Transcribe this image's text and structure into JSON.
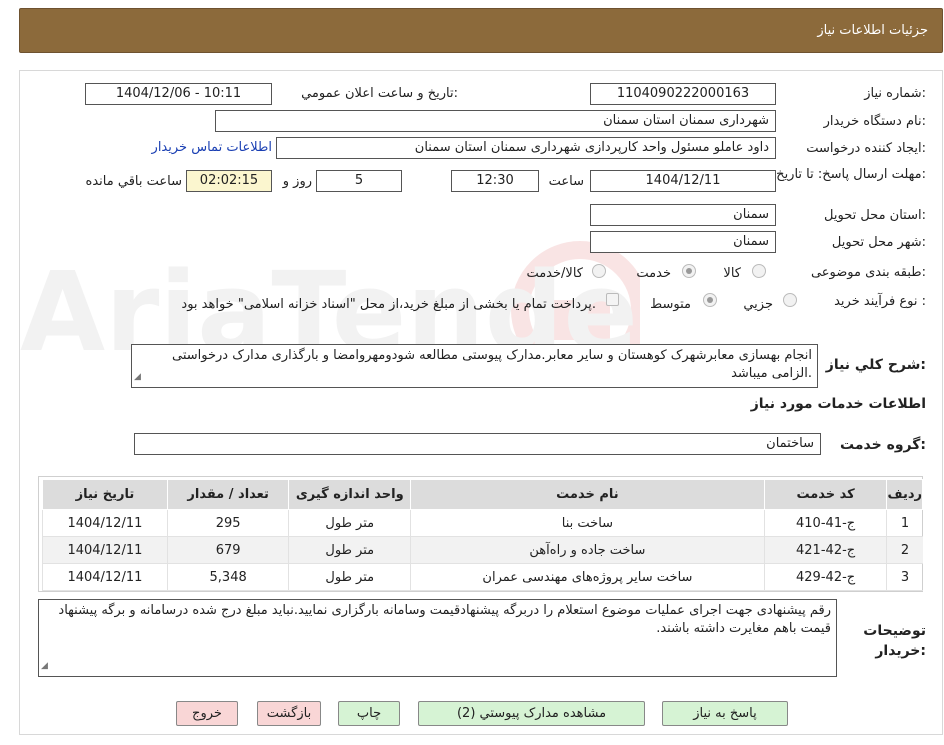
{
  "header": {
    "title": "جزئیات اطلاعات نیاز"
  },
  "fields": {
    "need_number_label": "شماره نیاز:",
    "need_number": "1104090222000163",
    "announce_label": "تاریخ و ساعت اعلان عمومي:",
    "announce_value": "1404/12/06 - 10:11",
    "buyer_org_label": "نام دستگاه خريدار:",
    "buyer_org": "شهرداری سمنان استان سمنان",
    "creator_label": "ایجاد کننده درخواست:",
    "creator": "داود عاملو مسئول واحد کارپردازی شهرداری سمنان استان سمنان",
    "contact_link": "اطلاعات تماس خريدار",
    "deadline_label": "مهلت ارسال پاسخ: تا تاریخ:",
    "deadline_date": "1404/12/11",
    "time_label": "ساعت",
    "deadline_time": "12:30",
    "days_value": "5",
    "days_label": "روز و",
    "remaining_time": "02:02:15",
    "remaining_label": "ساعت باقي مانده",
    "province_label": "استان محل تحویل:",
    "province": "سمنان",
    "city_label": "شهر محل تحویل:",
    "city": "سمنان",
    "category_label": "طبقه بندی موضوعی:",
    "category_options": [
      "کالا",
      "خدمت",
      "کالا/خدمت"
    ],
    "category_selected": "خدمت",
    "process_label": "نوع فرآیند خرید :",
    "process_options": [
      "جزيي",
      "متوسط"
    ],
    "process_selected": "متوسط",
    "payment_note": "پرداخت تمام یا بخشی از مبلغ خرید،از محل \"اسناد خزانه اسلامی\" خواهد بود."
  },
  "description": {
    "label": "شرح كلي نياز:",
    "text": "انجام بهسازی معابرشهرک کوهستان و سایر معابر.مدارک پیوستی مطالعه شودومهروامضا و بارگذاری مدارک درخواستی الزامی میباشد."
  },
  "services": {
    "section_title": "اطلاعات خدمات مورد نياز",
    "group_label": "گروه خدمت:",
    "group_value": "ساختمان",
    "columns": [
      "رديف",
      "کد خدمت",
      "نام خدمت",
      "واحد اندازه گیری",
      "تعداد / مقدار",
      "تاریخ نیاز"
    ],
    "rows": [
      {
        "idx": "1",
        "code": "ج-41-410",
        "name": "ساخت بنا",
        "unit": "متر طول",
        "qty": "295",
        "date": "1404/12/11"
      },
      {
        "idx": "2",
        "code": "ج-42-421",
        "name": "ساخت جاده و راه‌آهن",
        "unit": "متر طول",
        "qty": "679",
        "date": "1404/12/11"
      },
      {
        "idx": "3",
        "code": "ج-42-429",
        "name": "ساخت سایر پروژه‌های مهندسی عمران",
        "unit": "متر طول",
        "qty": "5,348",
        "date": "1404/12/11"
      }
    ]
  },
  "buyer_notes": {
    "label": "توضیحات خریدار:",
    "text": "رقم پیشنهادی جهت اجرای عملیات موضوع استعلام را دربرگه پیشنهادقیمت وسامانه بارگزاری نمایید.نباید مبلغ درج شده درسامانه و برگه پیشنهاد قیمت باهم مغایرت داشته باشند."
  },
  "buttons": {
    "reply": "پاسخ به نياز",
    "attachments": "مشاهده مدارک پيوستي (2)",
    "print": "چاپ",
    "back": "بازگشت",
    "exit": "خروج"
  },
  "colors": {
    "header": "#8c6a3b",
    "action_button": "#d6f3d4",
    "exit_button": "#f9d6d6",
    "highlight": "#fbf6cf"
  }
}
